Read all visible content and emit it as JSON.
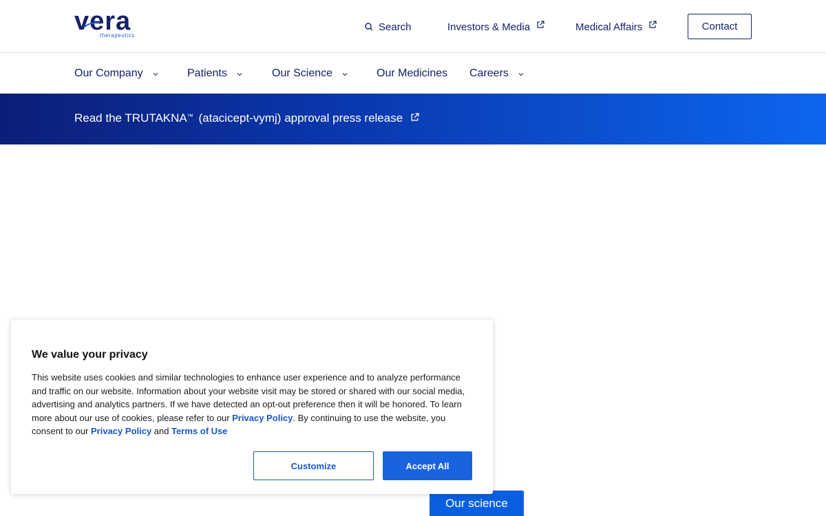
{
  "brand": {
    "logo_word": "vera",
    "logo_sub": "therapeutics"
  },
  "header": {
    "search_label": "Search",
    "investors_label": "Investors & Media",
    "medical_label": "Medical Affairs",
    "contact_label": "Contact"
  },
  "nav": {
    "items": [
      {
        "label": "Our Company",
        "has_dropdown": true
      },
      {
        "label": "Patients",
        "has_dropdown": true
      },
      {
        "label": "Our Science",
        "has_dropdown": true
      },
      {
        "label": "Our Medicines",
        "has_dropdown": false
      },
      {
        "label": "Careers",
        "has_dropdown": true
      }
    ]
  },
  "banner": {
    "prefix": "Read the TRUTAKNA",
    "trademark": "™",
    "suffix": " (atacicept-vymj) approval press release"
  },
  "cookie": {
    "title": "We value your privacy",
    "text_1": "This website uses cookies and similar technologies to enhance user experience and to analyze performance and traffic on our website. Information about your website visit may be stored or shared with our social media, advertising and analytics partners. If we have detected an opt-out preference then it will be honored. To learn more about our use of cookies, please refer to our ",
    "privacy_link_1": "Privacy Policy",
    "text_2": ". By continuing to use the website, you consent to our ",
    "privacy_link_2": "Privacy Policy",
    "text_3": " and ",
    "terms_link": "Terms of Use",
    "customize_label": "Customize",
    "accept_label": "Accept All"
  },
  "hero": {
    "science_button": "Our science"
  },
  "colors": {
    "navy": "#15206b",
    "accent_blue": "#1a63e0",
    "banner_start": "#0c1e78",
    "banner_end": "#0d66ef"
  },
  "icons": {
    "search": "search-icon",
    "external": "external-link-icon",
    "chevron": "chevron-down-icon"
  }
}
